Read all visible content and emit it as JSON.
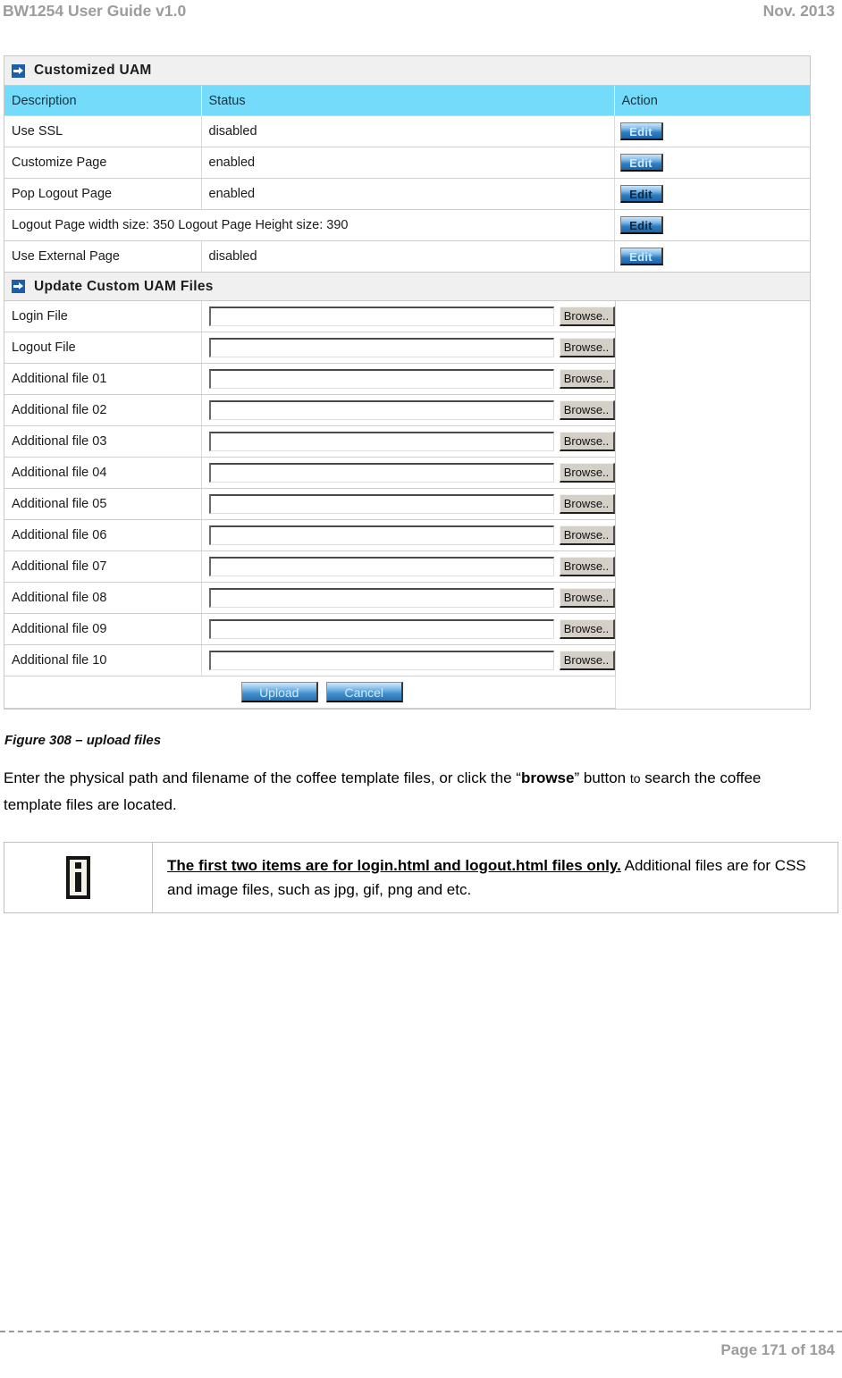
{
  "header": {
    "left": "BW1254 User Guide v1.0",
    "right": "Nov.  2013"
  },
  "panel": {
    "section1": {
      "icon": "arrow-square-icon",
      "title": "Customized UAM",
      "columns": [
        "Description",
        "Status",
        "Action"
      ],
      "rows": [
        {
          "description": "Use SSL",
          "status": "disabled",
          "action": "Edit",
          "span": false
        },
        {
          "description": "Customize Page",
          "status": "enabled",
          "action": "Edit",
          "span": false
        },
        {
          "description": "Pop Logout Page",
          "status": "enabled",
          "action": "Edit",
          "span": false
        },
        {
          "description": "Logout Page width size: 350  Logout Page Height size: 390",
          "status": "",
          "action": "Edit",
          "span": true
        },
        {
          "description": "Use External Page",
          "status": "disabled",
          "action": "Edit",
          "span": false
        }
      ]
    },
    "section2": {
      "icon": "arrow-square-icon",
      "title": "Update Custom UAM Files",
      "browse_label": "Browse..",
      "input_value": "",
      "input_placeholder": "",
      "rows": [
        {
          "label": "Login File"
        },
        {
          "label": "Logout File"
        },
        {
          "label": "Additional file 01"
        },
        {
          "label": "Additional file 02"
        },
        {
          "label": "Additional file 03"
        },
        {
          "label": "Additional file 04"
        },
        {
          "label": "Additional file 05"
        },
        {
          "label": "Additional file 06"
        },
        {
          "label": "Additional file 07"
        },
        {
          "label": "Additional file 08"
        },
        {
          "label": "Additional file 09"
        },
        {
          "label": "Additional file 10"
        }
      ],
      "upload_label": "Upload",
      "cancel_label": "Cancel"
    }
  },
  "figure": {
    "caption": "Figure 308  – upload files"
  },
  "body": {
    "part1": "Enter the physical path and filename of the coffee template files, or click the “",
    "bold": "browse",
    "part2": "” button ",
    "small": "to",
    "part3": "search the coffee template files are located."
  },
  "note": {
    "icon": "info-icon",
    "lead": "The first two items are for login.html and logout.html files only.",
    "rest": " Additional files are for CSS and image files, such as jpg, gif, png and etc."
  },
  "footer": {
    "page": "Page 171 of 184"
  },
  "colors": {
    "table_header_cyan": "#74dbfb",
    "section_bar_gray": "#f0f0f0",
    "header_text_gray": "#9c9c9c",
    "icon_blue": "#1b5faa"
  }
}
